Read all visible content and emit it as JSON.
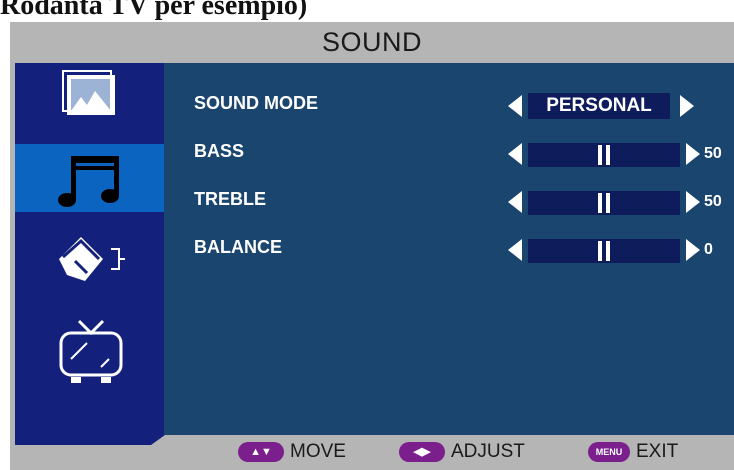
{
  "caption": "Rodanta TV per esempio)",
  "menu": {
    "title": "SOUND",
    "sidebar": [
      {
        "name": "picture-icon",
        "active": false
      },
      {
        "name": "music-note-icon",
        "active": true
      },
      {
        "name": "pen-setup-icon",
        "active": false
      },
      {
        "name": "tv-icon",
        "active": false
      }
    ],
    "rows": [
      {
        "label": "SOUND MODE",
        "value": "PERSONAL",
        "type": "option"
      },
      {
        "label": "BASS",
        "value": "50",
        "type": "slider",
        "level": 50
      },
      {
        "label": "TREBLE",
        "value": "50",
        "type": "slider",
        "level": 50
      },
      {
        "label": "BALANCE",
        "value": "0",
        "type": "slider",
        "level": 0
      }
    ]
  },
  "footer": {
    "move_key": "▲▼",
    "move_label": "MOVE",
    "adjust_key": "◀▶",
    "adjust_label": "ADJUST",
    "menu_key": "MENU",
    "exit_label": "EXIT"
  },
  "colors": {
    "frame": "#b5b5b5",
    "sidebar": "#14217c",
    "sidebar_active": "#0a64c0",
    "content": "#1a456e",
    "control": "#0f1c5c",
    "key_pill": "#7a1f8c"
  }
}
